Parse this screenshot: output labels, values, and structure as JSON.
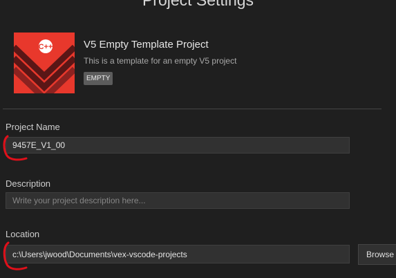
{
  "page": {
    "heading": "Project Settings"
  },
  "template_card": {
    "title": "V5 Empty Template Project",
    "description": "This is a template for an empty V5 project",
    "badge": "EMPTY",
    "icon": "cpp-template-logo",
    "icon_glyph": "C++"
  },
  "form": {
    "project_name": {
      "label": "Project Name",
      "value": "9457E_V1_00"
    },
    "description": {
      "label": "Description",
      "value": "",
      "placeholder": "Write your project description here..."
    },
    "location": {
      "label": "Location",
      "value": "c:\\Users\\jwood\\Documents\\vex-vscode-projects",
      "browse_label": "Browse"
    }
  },
  "colors": {
    "background": "#1f1f1f",
    "input_background": "#313131",
    "logo_red": "#e8382c",
    "logo_dark": "#5a1616",
    "badge": "#5c5c5c",
    "annotation_red": "#e0101a"
  }
}
